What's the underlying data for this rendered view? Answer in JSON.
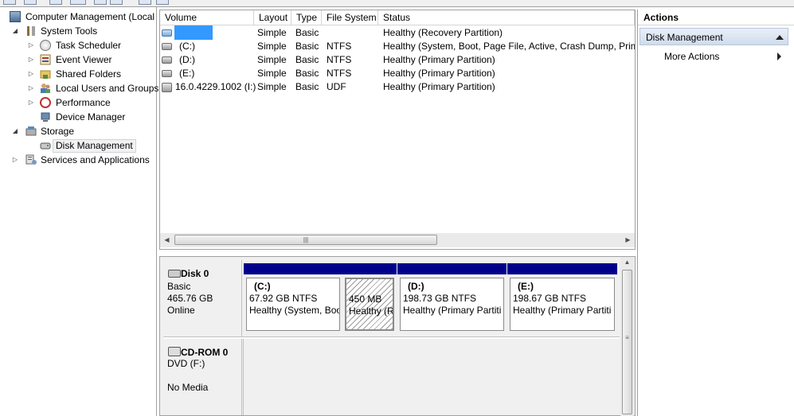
{
  "tree": {
    "root": "Computer Management (Local",
    "system_tools": "System Tools",
    "task_scheduler": "Task Scheduler",
    "event_viewer": "Event Viewer",
    "shared_folders": "Shared Folders",
    "local_users": "Local Users and Groups",
    "performance": "Performance",
    "device_manager": "Device Manager",
    "storage": "Storage",
    "disk_management": "Disk Management",
    "services": "Services and Applications"
  },
  "volumes": {
    "headers": {
      "volume": "Volume",
      "layout": "Layout",
      "type": "Type",
      "fs": "File System",
      "status": "Status"
    },
    "rows": [
      {
        "volume": "",
        "layout": "Simple",
        "type": "Basic",
        "fs": "",
        "status": "Healthy (Recovery Partition)"
      },
      {
        "volume": "(C:)",
        "layout": "Simple",
        "type": "Basic",
        "fs": "NTFS",
        "status": "Healthy (System, Boot, Page File, Active, Crash Dump, Prima"
      },
      {
        "volume": "(D:)",
        "layout": "Simple",
        "type": "Basic",
        "fs": "NTFS",
        "status": "Healthy (Primary Partition)"
      },
      {
        "volume": "(E:)",
        "layout": "Simple",
        "type": "Basic",
        "fs": "NTFS",
        "status": "Healthy (Primary Partition)"
      },
      {
        "volume": "16.0.4229.1002 (I:)",
        "layout": "Simple",
        "type": "Basic",
        "fs": "UDF",
        "status": "Healthy (Primary Partition)"
      }
    ],
    "redaction_color": "#3399ff"
  },
  "disks": {
    "disk0": {
      "name": "Disk 0",
      "type": "Basic",
      "size": "465.76 GB",
      "state": "Online",
      "partitions": [
        {
          "name": "(C:)",
          "size": "67.92 GB NTFS",
          "status": "Healthy (System, Boo"
        },
        {
          "name": "",
          "size": "450 MB",
          "status": "Healthy (R"
        },
        {
          "name": "(D:)",
          "size": "198.73 GB NTFS",
          "status": "Healthy (Primary Partiti"
        },
        {
          "name": "(E:)",
          "size": "198.67 GB NTFS",
          "status": "Healthy (Primary Partiti"
        }
      ]
    },
    "cdrom0": {
      "name": "CD-ROM 0",
      "type": "DVD (F:)",
      "media": "No Media"
    }
  },
  "actions": {
    "title": "Actions",
    "section": "Disk Management",
    "more": "More Actions"
  },
  "colors": {
    "primary_bar": "#00008b",
    "selection": "#f2f2f2"
  }
}
